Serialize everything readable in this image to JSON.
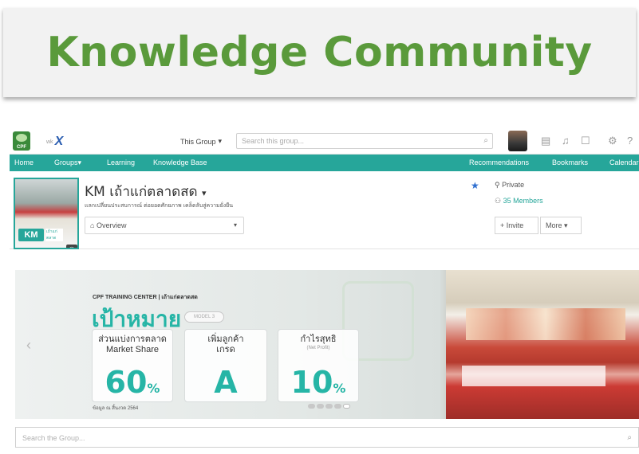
{
  "slide_title": "Knowledge Community",
  "topbar": {
    "brand_logo": "CPF",
    "app_logo": "X",
    "scope_label": "This Group",
    "search_placeholder": "Search this group...",
    "icons": [
      "calendar-icon",
      "bell-icon",
      "chat-icon",
      "gear-icon",
      "help-icon"
    ]
  },
  "nav": {
    "left": [
      "Home",
      "Groups",
      "Learning",
      "Knowledge Base"
    ],
    "right": [
      "Recommendations",
      "Bookmarks",
      "Calendar"
    ]
  },
  "group": {
    "name": "KM เถ้าแก่ตลาดสด",
    "description": "แลกเปลี่ยนประสบการณ์ ต่อยอดศักยภาพ เคล็ดลับสู่ความยั่งยืน",
    "badge": "KM",
    "badge_sub": "เถ้าแก่ตลาด",
    "view_select": "Overview",
    "privacy": "Private",
    "members": "35 Members",
    "invite_label": "Invite",
    "more_label": "More"
  },
  "banner": {
    "label": "CPF TRAINING CENTER | เถ้าแก่ตลาดสด",
    "goal_title": "เป้าหมาย",
    "goal_pill": "MODEL 3",
    "cards": [
      {
        "label": "ส่วนแบ่งการตลาด",
        "sub": "Market Share",
        "value": "60",
        "unit": "%"
      },
      {
        "label": "เพิ่มลูกค้า",
        "sub": "เกรด",
        "value": "A",
        "unit": ""
      },
      {
        "label": "กำไรสุทธิ",
        "sub": "(Net Profit)",
        "value": "10",
        "unit": "%"
      }
    ],
    "footnote": "ข้อมูล ณ สิ้นงวด 2564",
    "slide_count": 5,
    "active_slide": 5
  },
  "group_search_placeholder": "Search the Group..."
}
